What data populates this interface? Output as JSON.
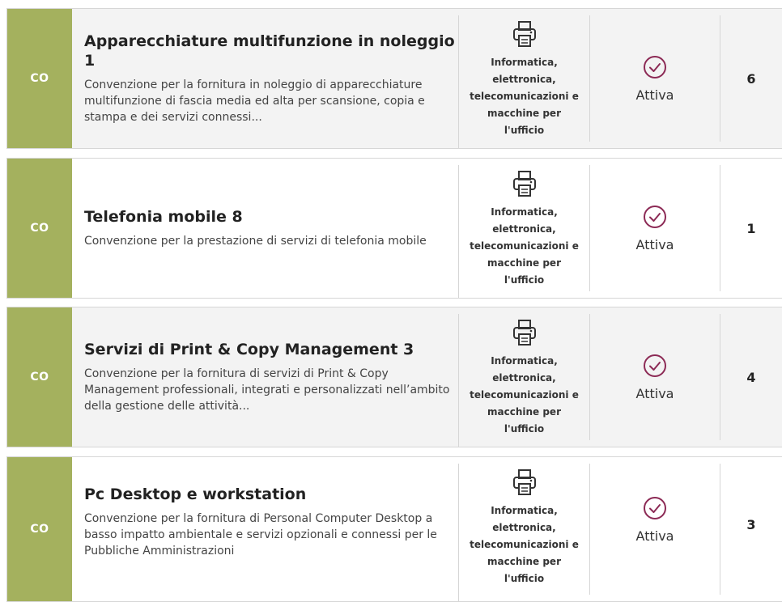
{
  "colors": {
    "badge": "#a4b15e",
    "status_accent": "#8c2a55",
    "row_alt": "#f3f3f3",
    "border": "#d6d6d6"
  },
  "items": [
    {
      "badge": "CO",
      "title": "Apparecchiature multifunzione in noleggio 1",
      "description": "Convenzione per la fornitura in noleggio di apparecchiature multifunzione di fascia media ed alta per scansione, copia e stampa e dei servizi connessi...",
      "category_icon": "printer-icon",
      "category_lines": [
        "Informatica,",
        "elettronica,",
        "telecomunicazioni e",
        "macchine per",
        "l'ufficio"
      ],
      "status_icon": "check-circle-icon",
      "status": "Attiva",
      "count": "6"
    },
    {
      "badge": "CO",
      "title": "Telefonia mobile 8",
      "description": "Convenzione per la prestazione di servizi di telefonia mobile",
      "category_icon": "printer-icon",
      "category_lines": [
        "Informatica,",
        "elettronica,",
        "telecomunicazioni e",
        "macchine per",
        "l'ufficio"
      ],
      "status_icon": "check-circle-icon",
      "status": "Attiva",
      "count": "1"
    },
    {
      "badge": "CO",
      "title": "Servizi di Print & Copy Management 3",
      "description": "Convenzione per la fornitura di servizi di Print & Copy Management professionali, integrati e personalizzati nell’ambito della gestione delle attività...",
      "category_icon": "printer-icon",
      "category_lines": [
        "Informatica,",
        "elettronica,",
        "telecomunicazioni e",
        "macchine per",
        "l'ufficio"
      ],
      "status_icon": "check-circle-icon",
      "status": "Attiva",
      "count": "4"
    },
    {
      "badge": "CO",
      "title": "Pc Desktop e workstation",
      "description": "Convenzione per la fornitura di Personal Computer Desktop a basso impatto ambientale e servizi opzionali e connessi per le Pubbliche Amministrazioni",
      "category_icon": "printer-icon",
      "category_lines": [
        "Informatica,",
        "elettronica,",
        "telecomunicazioni e",
        "macchine per",
        "l'ufficio"
      ],
      "status_icon": "check-circle-icon",
      "status": "Attiva",
      "count": "3"
    }
  ]
}
